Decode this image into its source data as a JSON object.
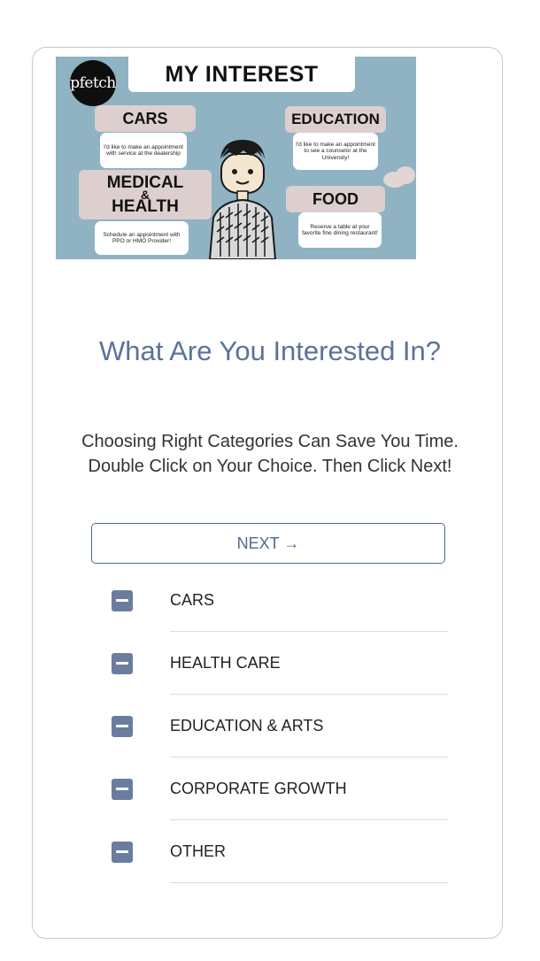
{
  "banner": {
    "logo_text": "pfetch",
    "title": "MY INTEREST",
    "tags": {
      "cars": "CARS",
      "education": "EDUCATION",
      "medical_line1": "MEDICAL",
      "medical_amp": "&",
      "medical_line2": "HEALTH",
      "food": "FOOD"
    },
    "bubbles": {
      "cars": "I'd like to make an appointment with service at the dealership",
      "education": "I'd like to make an appointment to see a counselor at the University!",
      "medical": "Schedule an appointment with PPO or HMO Provider!",
      "food": "Reserve a table at your favorite fine dining restaurant!"
    },
    "colors": {
      "background": "#8fb3c2",
      "tag": "#dccfcd"
    }
  },
  "heading": "What Are You Interested In?",
  "subtext": "Choosing Right Categories Can Save You Time. Double Click on Your Choice. Then Click Next!",
  "next_button": "NEXT →",
  "categories": [
    {
      "label": "CARS",
      "state": "indeterminate"
    },
    {
      "label": "HEALTH CARE",
      "state": "indeterminate"
    },
    {
      "label": "EDUCATION & ARTS",
      "state": "indeterminate"
    },
    {
      "label": "CORPORATE GROWTH",
      "state": "indeterminate"
    },
    {
      "label": "OTHER",
      "state": "indeterminate"
    }
  ],
  "colors": {
    "accent": "#5a7399",
    "checkbox": "#6a7da0",
    "button_border": "#4f6a94"
  }
}
